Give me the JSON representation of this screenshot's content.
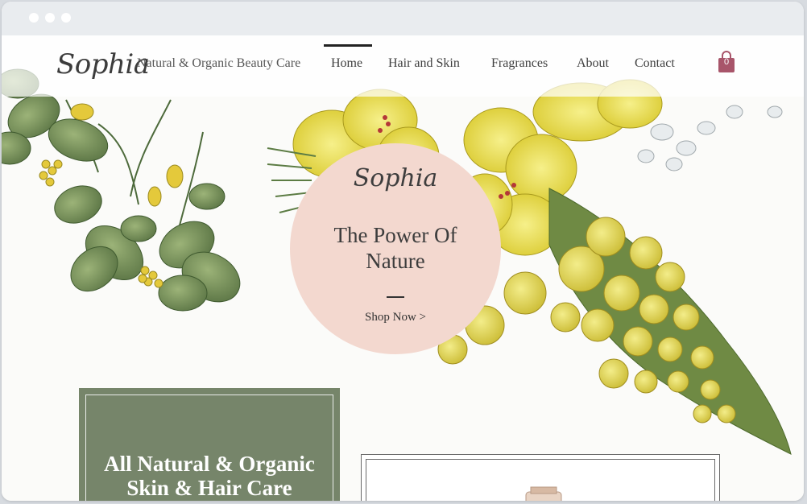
{
  "nav": {
    "logo": "Sophia",
    "tagline": "Natural & Organic Beauty Care",
    "items": [
      {
        "label": "Home"
      },
      {
        "label": "Hair and Skin"
      },
      {
        "label": "Fragrances"
      },
      {
        "label": "About"
      },
      {
        "label": "Contact"
      }
    ],
    "active": "Home",
    "cart_count": "0"
  },
  "hero": {
    "logo": "Sophia",
    "title_line1": "The Power Of",
    "title_line2": "Nature",
    "cta": "Shop Now >"
  },
  "feature": {
    "title_line1": "All Natural & Organic",
    "title_line2": "Skin & Hair Care"
  },
  "colors": {
    "pink": "#f3d8cf",
    "sage": "#76856a",
    "cart": "#a8556a"
  }
}
